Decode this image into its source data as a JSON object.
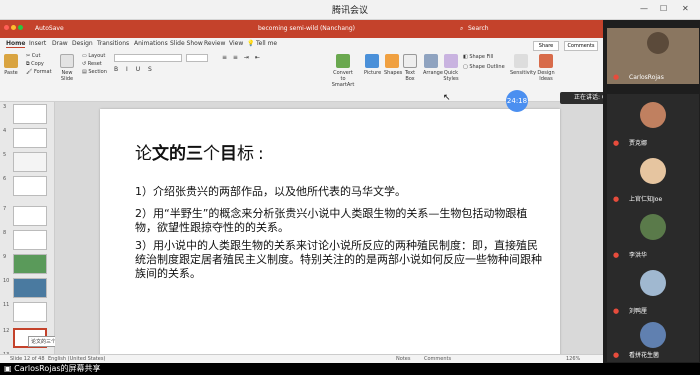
{
  "meeting": {
    "app_title": "腾讯会议",
    "speaking_label": "正在讲话: CarlosRojas;",
    "share_label": "CarlosRojas的屏幕共享",
    "timer": "24:18",
    "participants": [
      {
        "name": "CarlosRojas",
        "avatar": "#7a6a55"
      },
      {
        "name": "贾克娜",
        "avatar": "#c08060"
      },
      {
        "name": "上官仁知Joe",
        "avatar": "#e6c5a0"
      },
      {
        "name": "李洪华",
        "avatar": "#5a7a4a"
      },
      {
        "name": "刘鸭厘",
        "avatar": "#a0b8d0"
      },
      {
        "name": "看拼花生菌",
        "avatar": "#6080b0"
      }
    ]
  },
  "ppt": {
    "autosave": "AutoSave",
    "file_title": "becoming semi-wild (Nanchang)",
    "search": "Search",
    "tabs": [
      "Home",
      "Insert",
      "Draw",
      "Design",
      "Transitions",
      "Animations",
      "Slide Show",
      "Review",
      "View",
      "Tell me"
    ],
    "share": "Share",
    "comments": "Comments",
    "ribbon": {
      "paste": "Paste",
      "cut": "Cut",
      "copy": "Copy",
      "format": "Format",
      "new_slide": "New Slide",
      "layout": "Layout",
      "reset": "Reset",
      "section": "Section",
      "convert": "Convert to SmartArt",
      "picture": "Picture",
      "shapes": "Shapes",
      "text_box": "Text Box",
      "arrange": "Arrange",
      "quick_styles": "Quick Styles",
      "shape_fill": "Shape Fill",
      "shape_outline": "Shape Outline",
      "sensitivity": "Sensitivity",
      "design_ideas": "Design Ideas"
    },
    "thumb_numbers": [
      "3",
      "4",
      "5",
      "6",
      "7",
      "8",
      "9",
      "10",
      "11",
      "12",
      "13"
    ],
    "thumb_tooltip": "论文的三个目标",
    "status_slide": "Slide 12 of 48",
    "status_lang": "English (United States)",
    "status_notes": "Notes",
    "status_comments": "Comments",
    "status_zoom": "126%"
  },
  "slide": {
    "title_pre": "论",
    "title_bold_a": "文的三",
    "title_mid": "个",
    "title_bold_b": "目",
    "title_end": "标",
    "title_colon": ":",
    "points": [
      "1）介绍张贵兴的两部作品，以及他所代表的马华文学。",
      "2）用“半野生”的概念来分析张贵兴小说中人类跟生物的关系—生物包括动物跟植物，欲望性跟掠夺性的的关系。",
      "3）用小说中的人类跟生物的关系来讨论小说所反应的两种殖民制度：即，直接殖民统治制度跟定居者殖民主义制度。特别关注的的是两部小说如何反应一些物种间跟种族间的关系。"
    ]
  },
  "colors": {
    "ppt_accent": "#c4422b",
    "timer": "#4b8ff0"
  }
}
